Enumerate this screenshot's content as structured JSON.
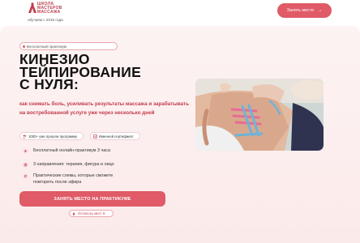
{
  "header": {
    "logo_lines": [
      "ШКОЛА",
      "МАСТЕРОВ",
      "МАССАЖА"
    ],
    "since": "обучаем с 2015 года",
    "cta_label": "Занять место"
  },
  "hero": {
    "chip": "Бесплатный практикум",
    "title_lines": [
      "КИНЕЗИО",
      "ТЕЙПИРОВАНИЕ",
      "С НУЛЯ:"
    ],
    "subtitle": "как снимать боль, усиливать результаты массажа и зарабатывать на востребованной услуге уже через несколько дней",
    "badges": [
      "1000+ уже прошли программу",
      "Именной сертификат"
    ],
    "features": [
      "Бесплатный онлайн-практикум 3 часа",
      "3 направления: терапия, фигура и лицо",
      "Практические схемы, которые сможете",
      "повторить после эфира"
    ],
    "cta_label": "ЗАНЯТЬ МЕСТО НА ПРАКТИКУМЕ",
    "seats_label": "Осталось мест 8"
  },
  "colors": {
    "accent": "#e05a67",
    "accent_dark": "#c23c4b",
    "hero_bg": "#fdf3f3"
  },
  "icons": [
    "logo-mark",
    "arrow-right-icon",
    "dot-icon",
    "users-icon",
    "certificate-icon",
    "play-icon",
    "layers-icon",
    "list-icon",
    "fire-icon"
  ]
}
